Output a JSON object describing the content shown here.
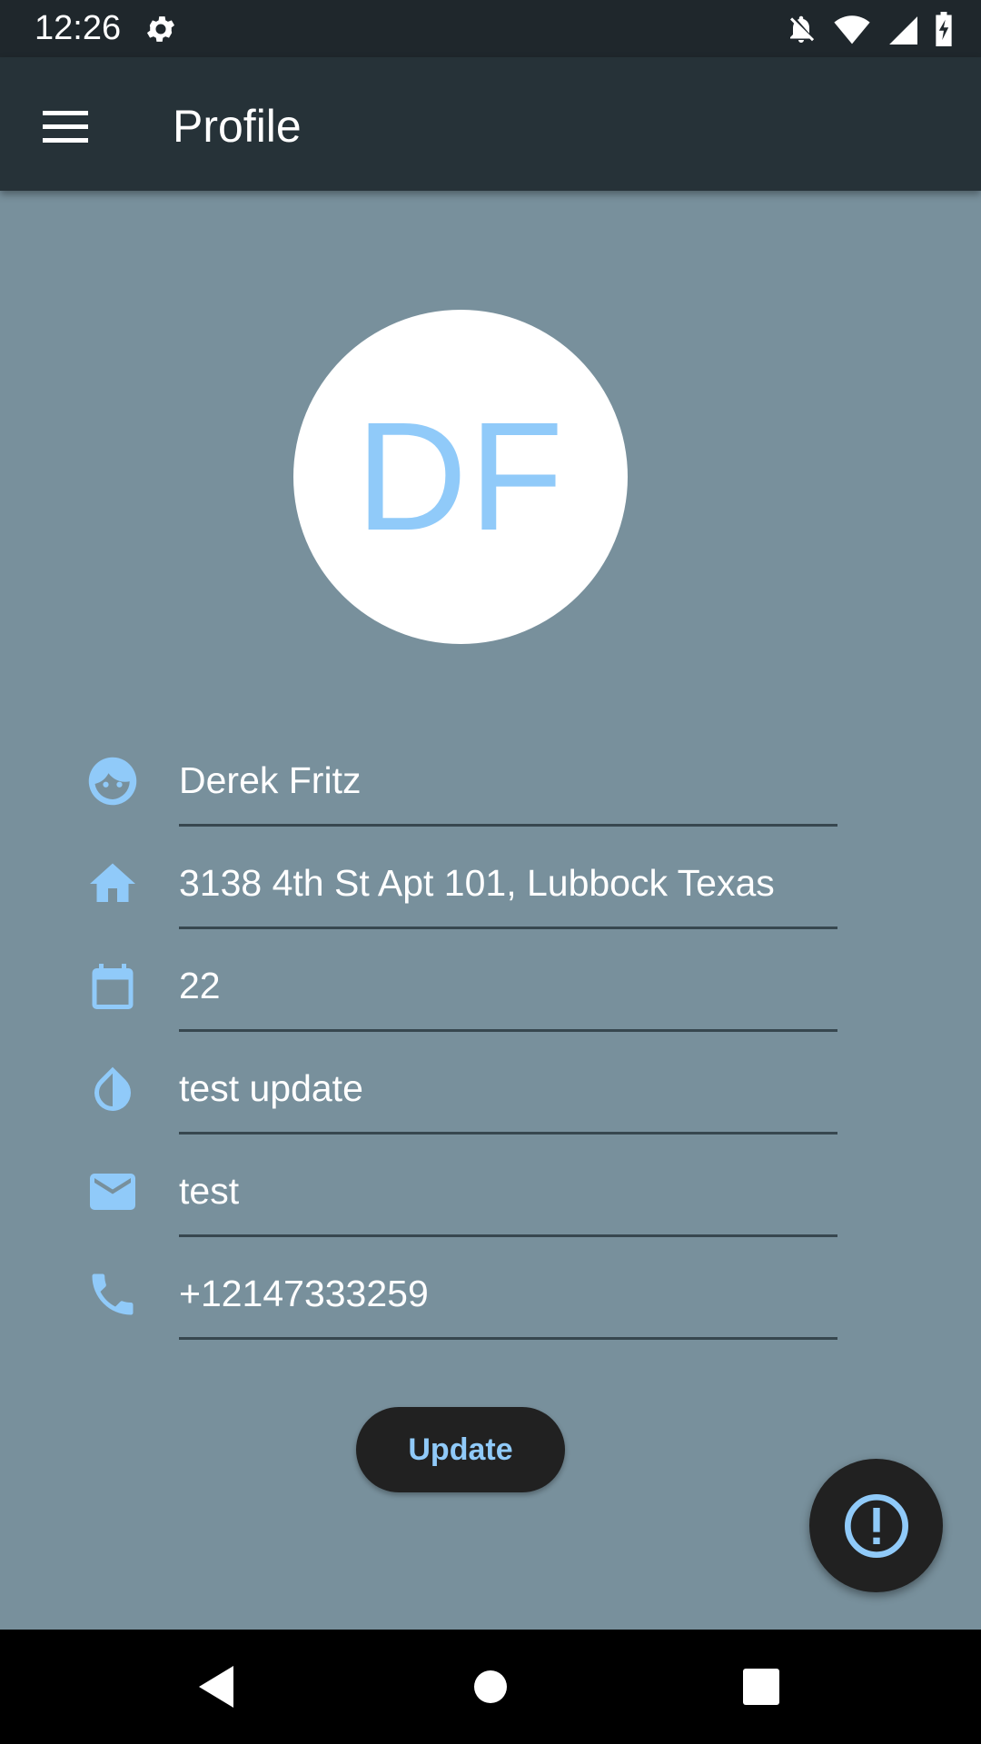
{
  "status_bar": {
    "time": "12:26",
    "icons": [
      "settings-icon",
      "notifications-off-icon",
      "wifi-icon",
      "signal-icon",
      "battery-charging-icon"
    ]
  },
  "app_bar": {
    "title": "Profile",
    "menu_icon": "menu-icon"
  },
  "avatar": {
    "initials": "DF"
  },
  "fields": {
    "name": {
      "icon": "face-icon",
      "value": "Derek Fritz"
    },
    "address": {
      "icon": "home-icon",
      "value": "3138 4th St Apt 101, Lubbock Texas"
    },
    "age": {
      "icon": "calendar-icon",
      "value": "22"
    },
    "blood": {
      "icon": "water-drop-icon",
      "value": "test update"
    },
    "email": {
      "icon": "email-icon",
      "value": "test"
    },
    "phone": {
      "icon": "phone-icon",
      "value": "+12147333259"
    }
  },
  "update_button": {
    "label": "Update"
  },
  "fab": {
    "icon": "alert-icon"
  },
  "colors": {
    "background": "#78909c",
    "app_bar": "#263238",
    "accent": "#90caf9",
    "button": "#212121"
  }
}
